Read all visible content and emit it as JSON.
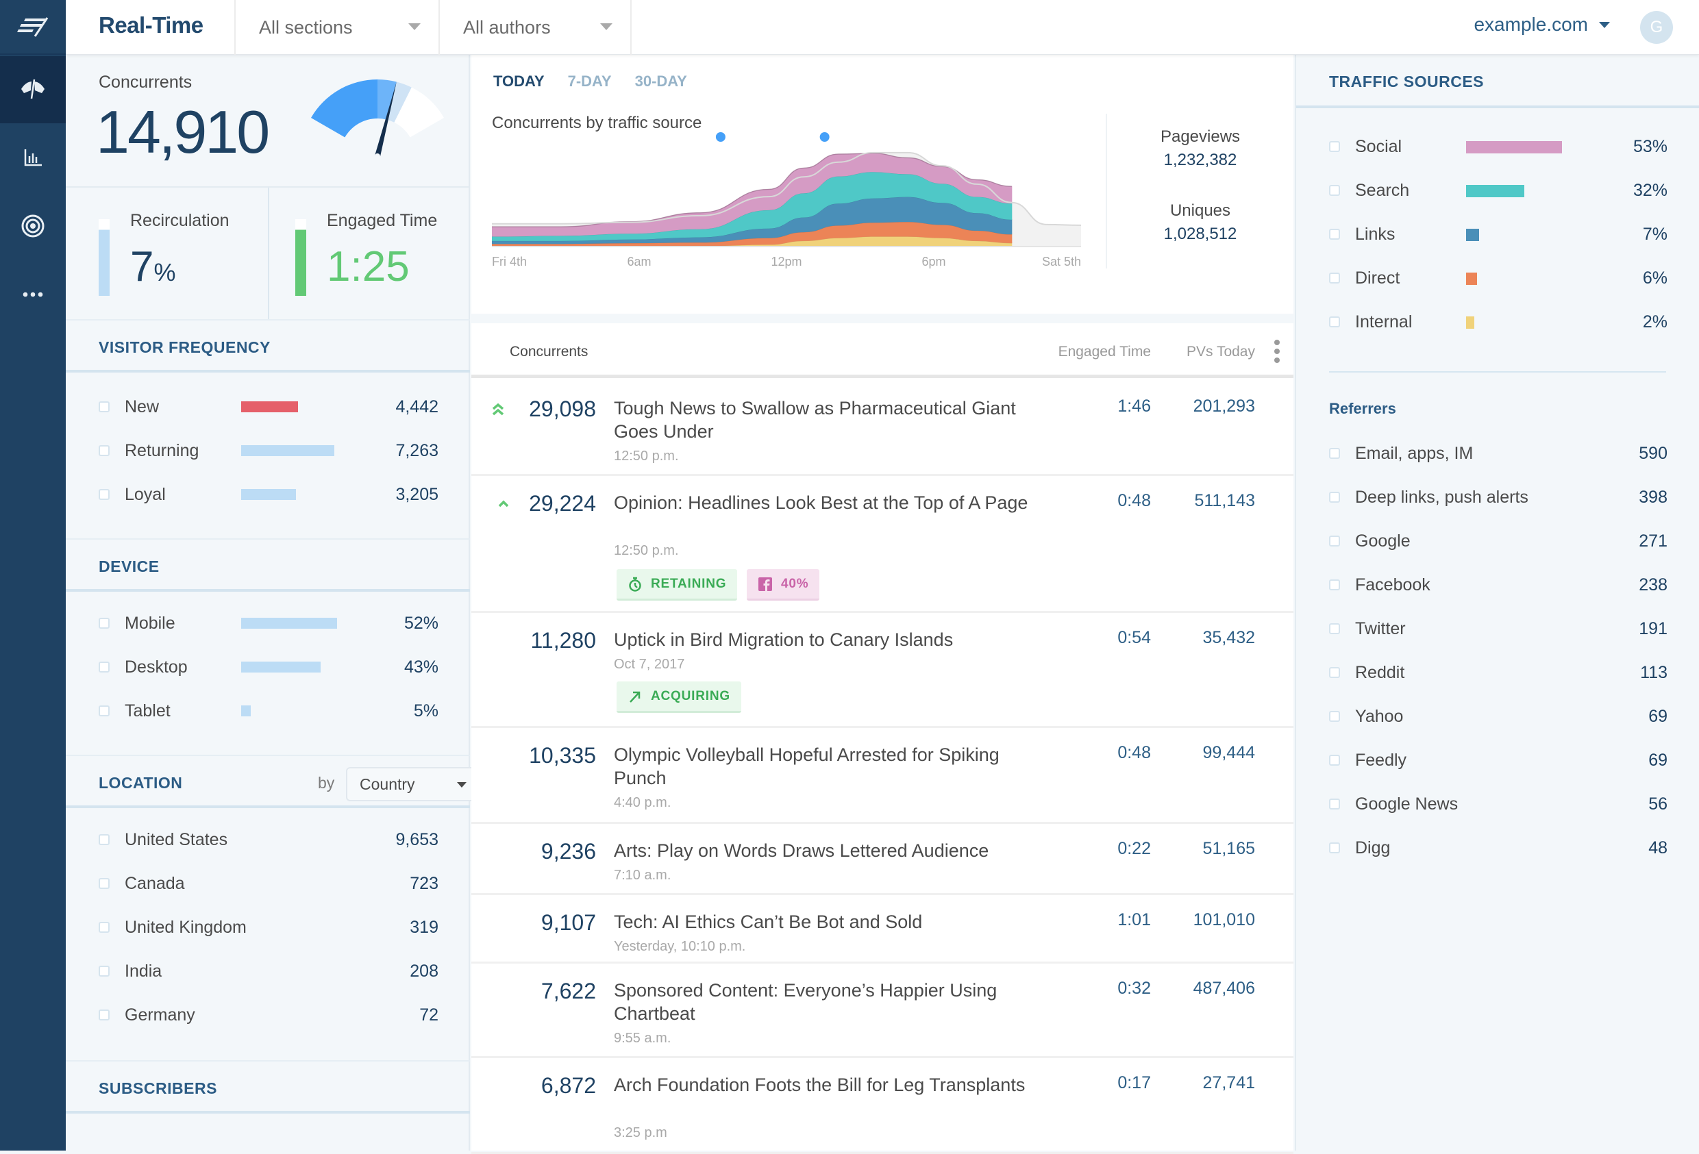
{
  "header": {
    "title": "Real-Time",
    "sections_dropdown": "All sections",
    "authors_dropdown": "All authors",
    "site": "example.com",
    "avatar_initial": "G"
  },
  "sidebar": {
    "items": [
      {
        "name": "logo",
        "icon": "chartbeat-logo-icon"
      },
      {
        "name": "real-time",
        "icon": "dashboard-gauge-icon",
        "active": true
      },
      {
        "name": "reports",
        "icon": "bar-chart-icon"
      },
      {
        "name": "goals",
        "icon": "target-icon"
      },
      {
        "name": "more",
        "icon": "more-horizontal-icon"
      }
    ]
  },
  "overview": {
    "concurrents_label": "Concurrents",
    "concurrents_value": "14,910",
    "gauge_fraction": 0.62,
    "recirculation_label": "Recirculation",
    "recirculation_value": "7",
    "recirculation_unit": "%",
    "recirculation_fill": 0.86,
    "engaged_label": "Engaged Time",
    "engaged_value": "1:25",
    "engaged_fill": 0.86
  },
  "visitor_frequency": {
    "title": "VISITOR FREQUENCY",
    "items": [
      {
        "label": "New",
        "value": "4,442",
        "fraction": 0.61,
        "color": "#e5606a"
      },
      {
        "label": "Returning",
        "value": "7,263",
        "fraction": 1.0,
        "color": "#bcdcf5"
      },
      {
        "label": "Loyal",
        "value": "3,205",
        "fraction": 0.59,
        "color": "#bcdcf5"
      }
    ]
  },
  "device": {
    "title": "DEVICE",
    "items": [
      {
        "label": "Mobile",
        "value": "52%",
        "fraction": 0.52
      },
      {
        "label": "Desktop",
        "value": "43%",
        "fraction": 0.43
      },
      {
        "label": "Tablet",
        "value": "5%",
        "fraction": 0.05
      }
    ]
  },
  "location": {
    "title": "LOCATION",
    "by_label": "by",
    "group_by": "Country",
    "items": [
      {
        "label": "United States",
        "value": "9,653"
      },
      {
        "label": "Canada",
        "value": "723"
      },
      {
        "label": "United Kingdom",
        "value": "319"
      },
      {
        "label": "India",
        "value": "208"
      },
      {
        "label": "Germany",
        "value": "72"
      }
    ]
  },
  "subscribers": {
    "title": "SUBSCRIBERS"
  },
  "chart": {
    "tabs": [
      {
        "label": "TODAY",
        "active": true
      },
      {
        "label": "7-DAY",
        "active": false
      },
      {
        "label": "30-DAY",
        "active": false
      }
    ],
    "title": "Concurrents by traffic source",
    "pageviews_label": "Pageviews",
    "pageviews_value": "1,232,382",
    "uniques_label": "Uniques",
    "uniques_value": "1,028,512"
  },
  "chart_data": {
    "type": "area",
    "title": "Concurrents by traffic source",
    "x_ticks": [
      "Fri 4th",
      "6am",
      "12pm",
      "6pm",
      "Sat 5th"
    ],
    "x": [
      0,
      2,
      4,
      6,
      8,
      9,
      10,
      11,
      12,
      13,
      14,
      15,
      16,
      17
    ],
    "series": [
      {
        "name": "Internal",
        "color": "#f0d27a",
        "values": [
          0.1,
          0.1,
          0.1,
          0.1,
          0.3,
          0.8,
          1.2,
          1.4,
          1.4,
          1.2,
          0.8,
          0.5,
          null,
          null
        ]
      },
      {
        "name": "Direct",
        "color": "#ec8457",
        "values": [
          0.3,
          0.3,
          0.4,
          0.5,
          0.9,
          1.2,
          1.7,
          1.9,
          2.0,
          1.8,
          1.4,
          1.2,
          null,
          null
        ]
      },
      {
        "name": "Links",
        "color": "#4a8fb8",
        "values": [
          0.4,
          0.4,
          0.5,
          0.7,
          1.3,
          2.0,
          3.0,
          3.3,
          3.4,
          3.0,
          2.4,
          2.0,
          null,
          null
        ]
      },
      {
        "name": "Search",
        "color": "#4fc8c7",
        "values": [
          0.6,
          0.7,
          0.8,
          1.1,
          2.5,
          3.3,
          3.7,
          3.6,
          3.1,
          2.6,
          2.2,
          2.2,
          null,
          null
        ]
      },
      {
        "name": "Social",
        "color": "#d59bc4",
        "values": [
          1.3,
          1.2,
          1.6,
          2.2,
          2.8,
          3.4,
          3.0,
          2.5,
          2.2,
          2.3,
          2.3,
          2.3,
          null,
          null
        ]
      }
    ],
    "previous_day_total": [
      3.1,
      3.1,
      3.3,
      4.2,
      6.8,
      9.5,
      11.5,
      12.8,
      12.8,
      11.0,
      8.5,
      6.0,
      3.0,
      2.9
    ],
    "markers": [
      6.6,
      9.6
    ],
    "ylim": [
      0,
      14
    ],
    "current_hour": 16
  },
  "articles": {
    "columns": {
      "concurrents": "Concurrents",
      "engaged": "Engaged Time",
      "pvs": "PVs Today"
    },
    "items": [
      {
        "trend": "double-up",
        "concurrents": "29,098",
        "title": "Tough News to Swallow as Pharmaceutical Giant Goes Under",
        "time": "12:50 p.m.",
        "engaged": "1:46",
        "pvs": "201,293",
        "badges": []
      },
      {
        "trend": "up",
        "concurrents": "29,224",
        "title": "Opinion: Headlines Look Best at the Top of A Page",
        "time": "12:50 p.m.",
        "engaged": "0:48",
        "pvs": "511,143",
        "badges": [
          {
            "type": "retaining",
            "label": "RETAINING"
          },
          {
            "type": "facebook",
            "label": "40%"
          }
        ]
      },
      {
        "trend": "",
        "concurrents": "11,280",
        "title": "Uptick in Bird Migration to Canary Islands",
        "time": "Oct 7, 2017",
        "engaged": "0:54",
        "pvs": "35,432",
        "badges": [
          {
            "type": "acquiring",
            "label": "ACQUIRING"
          }
        ]
      },
      {
        "trend": "",
        "concurrents": "10,335",
        "title": "Olympic Volleyball Hopeful Arrested for Spiking Punch",
        "time": "4:40 p.m.",
        "engaged": "0:48",
        "pvs": "99,444",
        "badges": []
      },
      {
        "trend": "",
        "concurrents": "9,236",
        "title": "Arts: Play on Words Draws Lettered Audience",
        "time": "7:10 a.m.",
        "engaged": "0:22",
        "pvs": "51,165",
        "badges": []
      },
      {
        "trend": "",
        "concurrents": "9,107",
        "title": "Tech: AI Ethics Can’t Be Bot and Sold",
        "time": "Yesterday, 10:10 p.m.",
        "engaged": "1:01",
        "pvs": "101,010",
        "badges": []
      },
      {
        "trend": "",
        "concurrents": "7,622",
        "title": "Sponsored Content: Everyone’s Happier Using Chartbeat",
        "time": "9:55 a.m.",
        "engaged": "0:32",
        "pvs": "487,406",
        "badges": []
      },
      {
        "trend": "",
        "concurrents": "6,872",
        "title": "Arch Foundation Foots the Bill for Leg Transplants",
        "time": "3:25 p.m",
        "engaged": "0:17",
        "pvs": "27,741",
        "badges": []
      }
    ]
  },
  "traffic_sources": {
    "title": "TRAFFIC SOURCES",
    "items": [
      {
        "label": "Social",
        "value": "53%",
        "fraction": 0.53,
        "color": "#d59bc4"
      },
      {
        "label": "Search",
        "value": "32%",
        "fraction": 0.32,
        "color": "#4fc8c7"
      },
      {
        "label": "Links",
        "value": "7%",
        "fraction": 0.07,
        "color": "#4a8fb8"
      },
      {
        "label": "Direct",
        "value": "6%",
        "fraction": 0.06,
        "color": "#ec8457"
      },
      {
        "label": "Internal",
        "value": "2%",
        "fraction": 0.02,
        "color": "#f0d27a"
      }
    ]
  },
  "referrers": {
    "title": "Referrers",
    "items": [
      {
        "label": "Email, apps, IM",
        "value": "590"
      },
      {
        "label": "Deep links, push alerts",
        "value": "398"
      },
      {
        "label": "Google",
        "value": "271"
      },
      {
        "label": "Facebook",
        "value": "238"
      },
      {
        "label": "Twitter",
        "value": "191"
      },
      {
        "label": "Reddit",
        "value": "113"
      },
      {
        "label": "Yahoo",
        "value": "69"
      },
      {
        "label": "Feedly",
        "value": "69"
      },
      {
        "label": "Google News",
        "value": "56"
      },
      {
        "label": "Digg",
        "value": "48"
      }
    ]
  }
}
